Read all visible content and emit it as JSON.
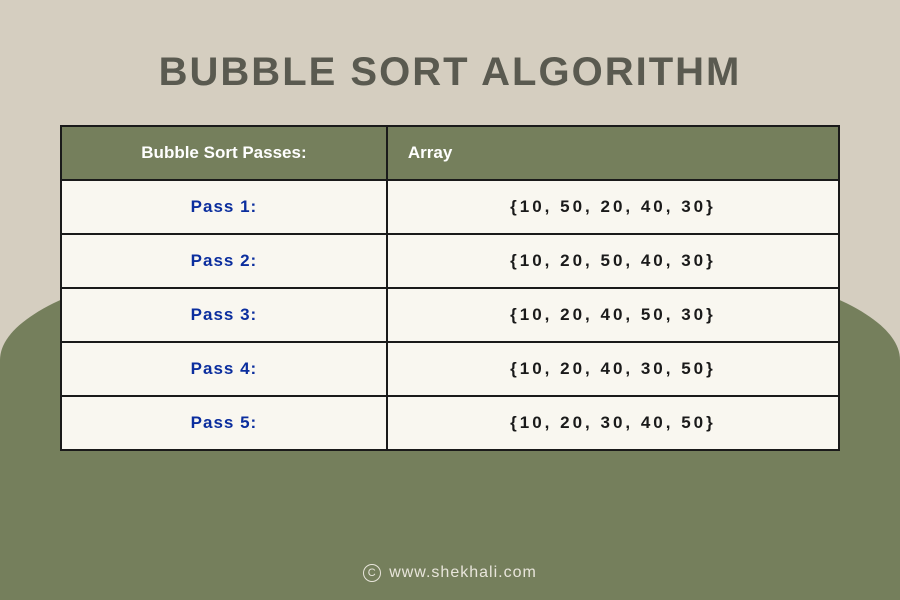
{
  "title": "BUBBLE SORT ALGORITHM",
  "table": {
    "header": {
      "left": "Bubble Sort Passes:",
      "right": "Array"
    },
    "rows": [
      {
        "pass": "Pass 1:",
        "array": "{10, 50, 20, 40, 30}"
      },
      {
        "pass": "Pass 2:",
        "array": "{10, 20, 50, 40, 30}"
      },
      {
        "pass": "Pass 3:",
        "array": "{10, 20, 40, 50, 30}"
      },
      {
        "pass": "Pass 4:",
        "array": "{10, 20, 40, 30, 50}"
      },
      {
        "pass": "Pass 5:",
        "array": "{10, 20, 30, 40, 50}"
      }
    ]
  },
  "footer": {
    "copyright_symbol": "C",
    "url": "www.shekhali.com"
  }
}
